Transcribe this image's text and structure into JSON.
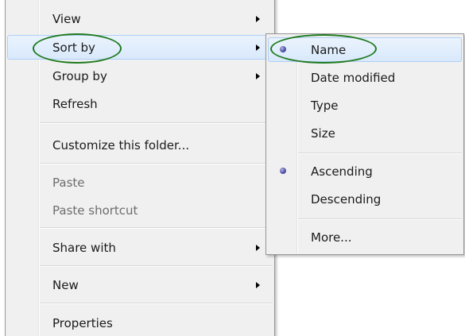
{
  "context_menu": {
    "items": [
      {
        "label": "View",
        "has_submenu": true
      },
      {
        "label": "Sort by",
        "has_submenu": true,
        "highlighted": true
      },
      {
        "label": "Group by",
        "has_submenu": true
      },
      {
        "label": "Refresh",
        "has_submenu": false
      },
      {
        "label": "Customize this folder...",
        "has_submenu": false
      },
      {
        "label": "Paste",
        "has_submenu": false,
        "disabled": true
      },
      {
        "label": "Paste shortcut",
        "has_submenu": false,
        "disabled": true
      },
      {
        "label": "Share with",
        "has_submenu": true
      },
      {
        "label": "New",
        "has_submenu": true
      },
      {
        "label": "Properties",
        "has_submenu": false
      }
    ]
  },
  "sort_submenu": {
    "items": [
      {
        "label": "Name",
        "selected": true
      },
      {
        "label": "Date modified",
        "selected": false
      },
      {
        "label": "Type",
        "selected": false
      },
      {
        "label": "Size",
        "selected": false
      },
      {
        "label": "Ascending",
        "selected": true
      },
      {
        "label": "Descending",
        "selected": false
      },
      {
        "label": "More...",
        "selected": false
      }
    ]
  },
  "colors": {
    "menu_background": "#f0f0f0",
    "hover_border": "#aecff7",
    "annotation_ellipse": "#1f7a1f",
    "radio_bullet": "#5252a6"
  }
}
